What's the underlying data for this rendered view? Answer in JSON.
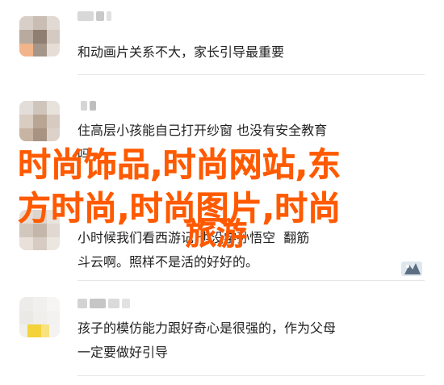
{
  "comments": [
    {
      "text": "和动画片关系不大，家长引导最重要"
    },
    {
      "text": "住高层小孩能自己打开纱窗 也没有安全教育\n吗"
    },
    {
      "text": "小时候我们看西游记 也没学孙悟空  翻筋\n斗云啊。照样不是活的好好的。"
    },
    {
      "text": "孩子的模仿能力跟好奇心是很强的，作为父母\n一定要做好引导"
    }
  ],
  "overlay": {
    "line1": "时尚饰品,时尚网站,东",
    "line2": "方时尚,时尚图片,时尚",
    "line3": "旅游"
  },
  "colors": {
    "overlay": "#ff5a00",
    "divider": "#e6e6e6"
  }
}
